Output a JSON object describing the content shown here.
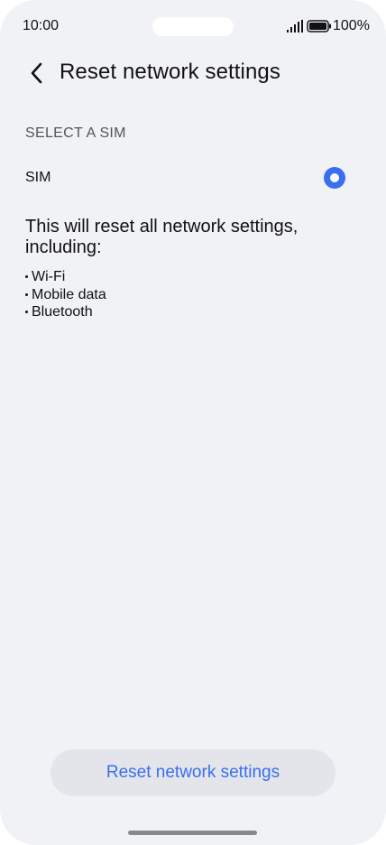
{
  "status_bar": {
    "time": "10:00",
    "battery_percent": "100%",
    "signal_icon": "cellular-signal-icon",
    "battery_icon": "battery-full-icon"
  },
  "header": {
    "back_icon": "chevron-left-icon",
    "title": "Reset network settings"
  },
  "sim_section": {
    "label": "SELECT A SIM",
    "option": {
      "label": "SIM",
      "selected": true
    }
  },
  "description": "This will reset all network settings, including:",
  "items": [
    "Wi-Fi",
    "Mobile data",
    "Bluetooth"
  ],
  "action_button": {
    "label": "Reset network settings"
  },
  "colors": {
    "accent": "#3a6ef0",
    "background": "#f1f2f6",
    "button_bg": "#e3e5ea"
  }
}
